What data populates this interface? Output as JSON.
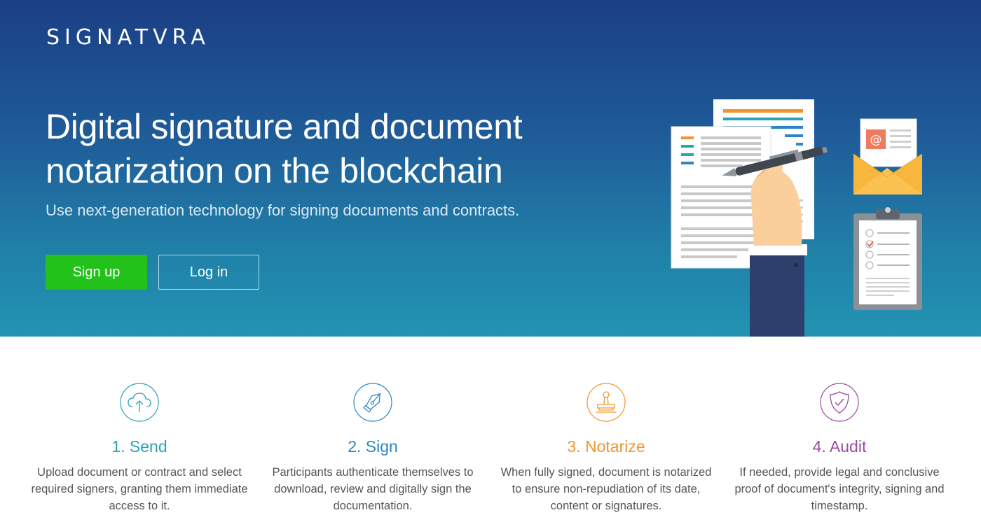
{
  "header": {
    "logo": "SIGNATVRA"
  },
  "hero": {
    "headline": "Digital signature and document notarization on the blockchain",
    "subheadline": "Use next-generation technology for signing documents and contracts.",
    "signup_label": "Sign up",
    "login_label": "Log in"
  },
  "features": [
    {
      "icon": "cloud-upload-icon",
      "title": "1. Send",
      "color": "#2aa4b5",
      "description": "Upload document or contract and select required signers, granting them immediate access to it."
    },
    {
      "icon": "pen-nib-icon",
      "title": "2. Sign",
      "color": "#2a86c7",
      "description": "Participants authenticate themselves to download, review and digitally sign the documentation."
    },
    {
      "icon": "stamp-icon",
      "title": "3. Notarize",
      "color": "#f0962e",
      "description": "When fully signed, document is notarized to ensure non-repudiation of its date, content or signatures."
    },
    {
      "icon": "shield-check-icon",
      "title": "4. Audit",
      "color": "#9b4ba3",
      "description": "If needed, provide legal and conclusive proof of document's integrity, signing and timestamp."
    }
  ],
  "colors": {
    "hero_top": "#1b3f85",
    "hero_bottom": "#2393b3",
    "signup_button": "#22c21a"
  }
}
